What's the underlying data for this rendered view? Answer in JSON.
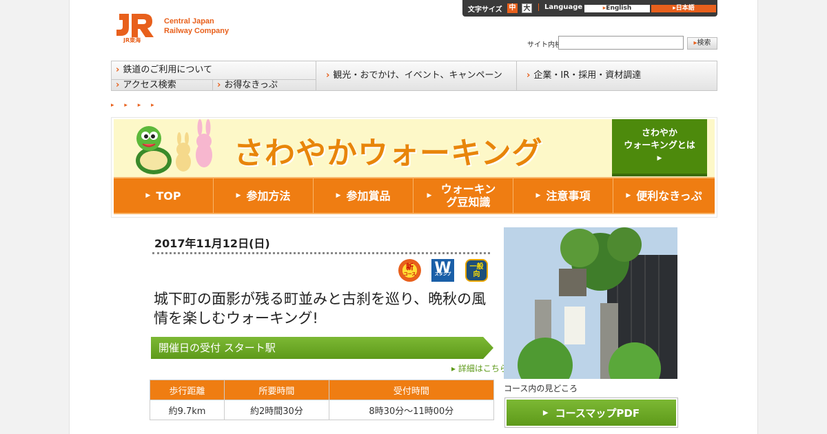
{
  "header": {
    "logo_mark": "JR",
    "logo_sub": "JR東海",
    "company_line1": "Central Japan",
    "company_line2": "Railway Company",
    "util": {
      "text_size_label": "文字サイズ",
      "size_mid": "中",
      "size_big": "大",
      "language_label": "Language",
      "lang_en": "English",
      "lang_ja": "日本語"
    },
    "search": {
      "label": "サイト内検索",
      "placeholder": "",
      "button": "検索"
    }
  },
  "gnav": {
    "rail": "鉄道のご利用について",
    "access": "アクセス検索",
    "ticket": "お得なきっぷ",
    "kanko": "観光・おでかけ、イベント、キャンペーン",
    "ir": "企業・IR・採用・資材調達"
  },
  "breadcrumb": "▸ ▸ ▸ ▸",
  "banner": {
    "title": "さわやかウォーキング",
    "about_line1": "さわやか",
    "about_line2": "ウォーキングとは",
    "about_arrow": "▶",
    "tabs": [
      {
        "label": "TOP"
      },
      {
        "label": "参加方法"
      },
      {
        "label": "参加賞品"
      },
      {
        "label": "ウォーキング豆知識"
      },
      {
        "label": "注意事項"
      },
      {
        "label": "便利なきっぷ"
      }
    ]
  },
  "event": {
    "date": "2017年11月12日(日)",
    "badges": {
      "new_top": "新",
      "new_bottom": "コース",
      "w": "W",
      "w_sub": "スタンプ",
      "ippan": "一般向"
    },
    "title": "城下町の面影が残る町並みと古刹を巡り、晩秋の風情を楽しむウォーキング!",
    "section": "開催日の受付 スタート駅",
    "detail_link": "詳細はこちら",
    "table": {
      "headers": [
        "歩行距離",
        "所要時間",
        "受付時間"
      ],
      "values": [
        "約9.7km",
        "約2時間30分",
        "8時30分～11時00分"
      ]
    },
    "photo_caption": "コース内の見どころ",
    "pdf_button": "コースマップPDF"
  }
}
